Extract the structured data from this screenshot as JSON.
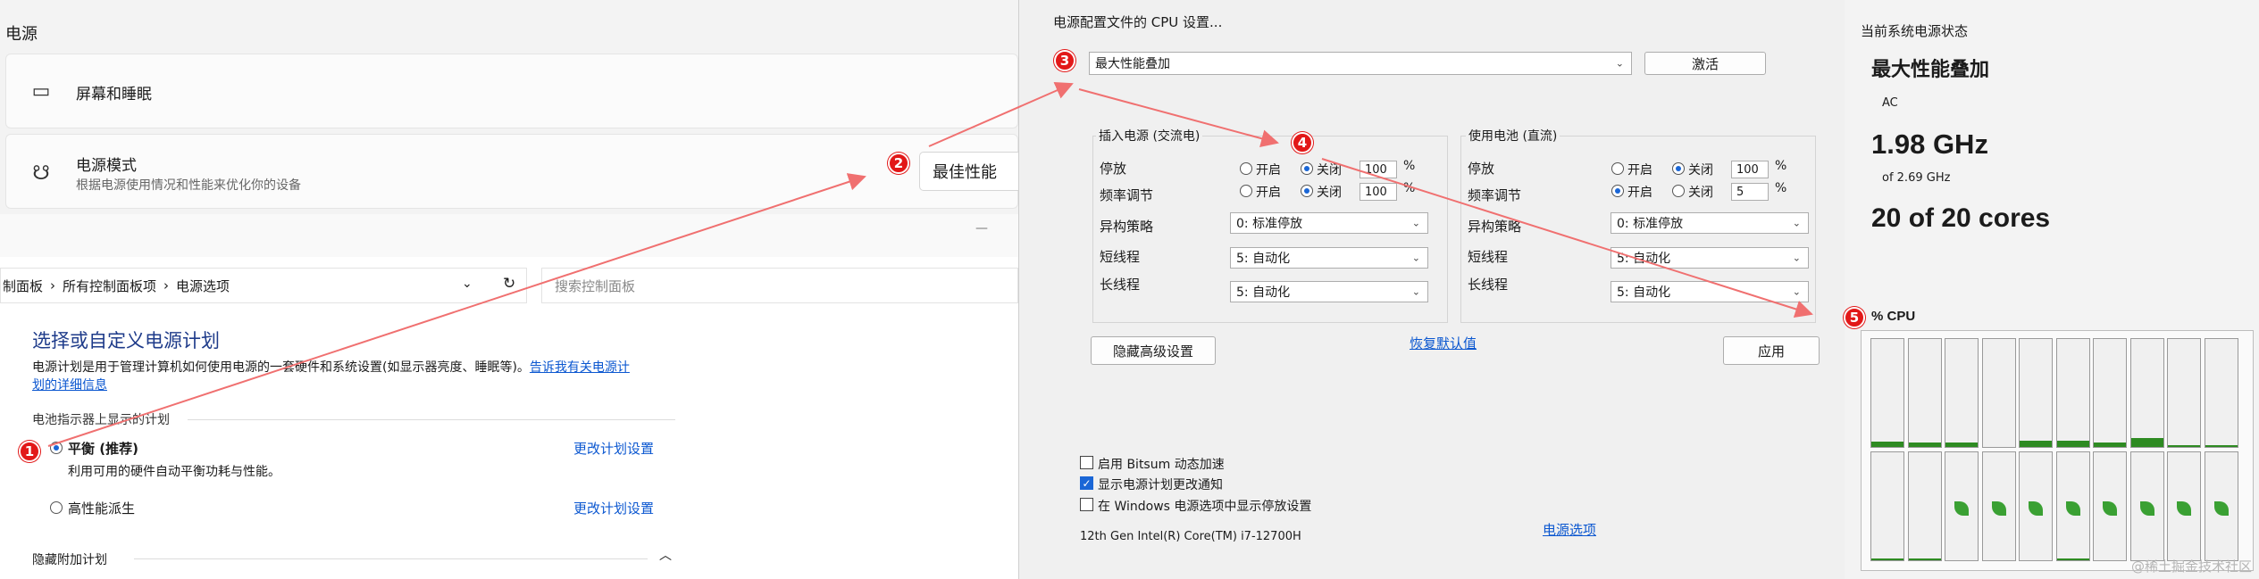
{
  "settings": {
    "title": "电源",
    "screen_sleep": "屏幕和睡眠",
    "power_mode": "电源模式",
    "power_mode_desc": "根据电源使用情况和性能来优化你的设备",
    "power_mode_value": "最佳性能"
  },
  "control_panel": {
    "minimize": "—",
    "breadcrumb": [
      "制面板",
      "所有控制面板项",
      "电源选项"
    ],
    "search_placeholder": "搜索控制面板",
    "heading": "选择或自定义电源计划",
    "desc": "电源计划是用于管理计算机如何使用电源的一套硬件和系统设置(如显示器亮度、睡眠等)。",
    "desc_link_1": "告诉我有关电源计",
    "desc_link_2": "划的详细信息",
    "section": "电池指示器上显示的计划",
    "plans": [
      {
        "name": "平衡 (推荐)",
        "desc": "利用可用的硬件自动平衡功耗与性能。",
        "link": "更改计划设置",
        "selected": true
      },
      {
        "name": "高性能派生",
        "desc": "",
        "link": "更改计划设置",
        "selected": false
      }
    ],
    "hidden_plans": "隐藏附加计划"
  },
  "cpu": {
    "title": "电源配置文件的 CPU 设置...",
    "profile": "最大性能叠加",
    "activate": "激活",
    "ac_group": "插入电源 (交流电)",
    "dc_group": "使用电池 (直流)",
    "park_label": "停放",
    "freq_label": "频率调节",
    "hetero_label": "异构策略",
    "short_label": "短线程",
    "long_label": "长线程",
    "on": "开启",
    "off": "关闭",
    "pct": "%",
    "ac": {
      "park_value": "100",
      "freq_value": "100",
      "hetero": "0: 标准停放",
      "short": "5: 自动化",
      "long": "5: 自动化"
    },
    "dc": {
      "park_value": "100",
      "freq_value": "5",
      "hetero": "0: 标准停放",
      "short": "5: 自动化",
      "long": "5: 自动化"
    },
    "hide_advanced": "隐藏高级设置",
    "restore_default": "恢复默认值",
    "apply": "应用",
    "chk_bitsum": "启用 Bitsum 动态加速",
    "chk_notify": "显示电源计划更改通知",
    "chk_park": "在 Windows 电源选项中显示停放设置",
    "processor": "12th Gen Intel(R) Core(TM) i7-12700H",
    "power_options_link": "电源选项"
  },
  "status": {
    "title": "当前系统电源状态",
    "plan": "最大性能叠加",
    "source": "AC",
    "freq": "1.98 GHz",
    "freq_of": "of 2.69 GHz",
    "cores": "20 of 20 cores",
    "graph_label": "% CPU",
    "top_row_levels": [
      0.05,
      0.04,
      0.04,
      0.0,
      0.06,
      0.06,
      0.04,
      0.08,
      0.02,
      0.02
    ],
    "bottom_row_levels": [
      0.01,
      0.01,
      0.0,
      0.0,
      0.0,
      0.01,
      0.0,
      0.0,
      0.0,
      0.0
    ],
    "bottom_row_parked": [
      false,
      false,
      true,
      true,
      true,
      true,
      true,
      true,
      true,
      true
    ]
  },
  "badges": [
    "1",
    "2",
    "3",
    "4",
    "5"
  ],
  "watermark": "@稀土掘金技术社区",
  "colors": {
    "accent": "#1a66d6",
    "badge": "#e21818",
    "arrow": "#f07070",
    "cpu_fill": "#2e8b22"
  }
}
